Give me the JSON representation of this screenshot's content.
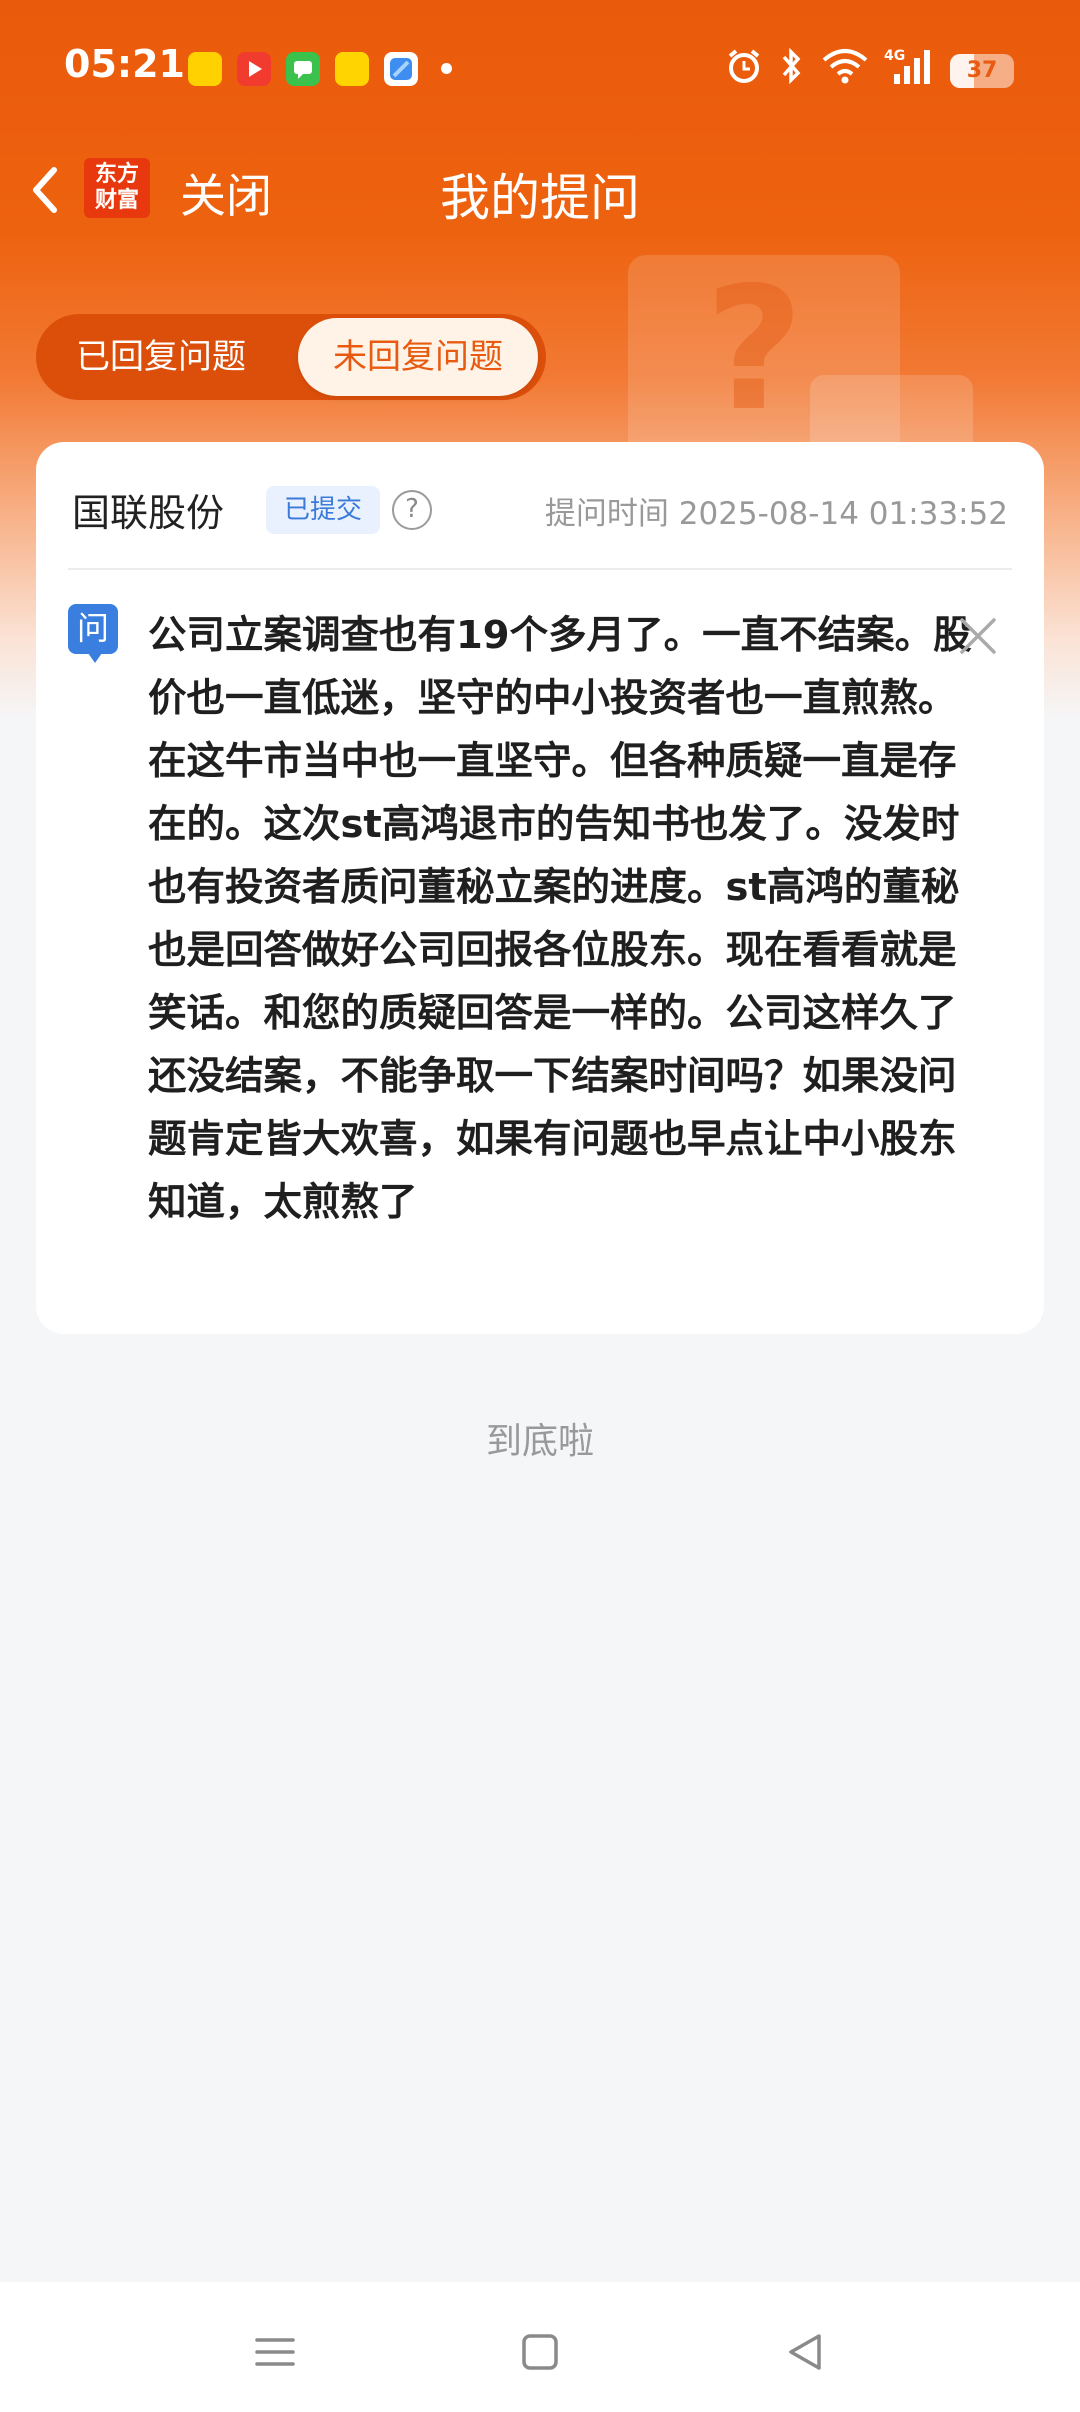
{
  "status_bar": {
    "time": "05:21",
    "network": "4G",
    "battery": "37",
    "battery_level": 0.37,
    "notification_apps": [
      "meituan-app-icon",
      "video-app-icon",
      "messages-app-icon",
      "yellow-app-icon",
      "blue-app-icon"
    ]
  },
  "header": {
    "brand_line1": "东方",
    "brand_line2": "财富",
    "close_label": "关闭",
    "title": "我的提问"
  },
  "tabs": [
    {
      "label": "已回复问题",
      "selected": false
    },
    {
      "label": "未回复问题",
      "selected": true
    }
  ],
  "question_card": {
    "company": "国联股份",
    "status_badge": "已提交",
    "help_glyph": "?",
    "ask_time": "提问时间 2025-08-14 01:33:52",
    "question_tag": "问",
    "question_text": "公司立案调查也有19个多月了。一直不结案。股价也一直低迷，坚守的中小投资者也一直煎熬。在这牛市当中也一直坚守。但各种质疑一直是存在的。这次st高鸿退市的告知书也发了。没发时也有投资者质问董秘立案的进度。st高鸿的董秘也是回答做好公司回报各位股东。现在看看就是笑话。和您的质疑回答是一样的。公司这样久了还没结案，不能争取一下结案时间吗？如果没问题肯定皆大欢喜，如果有问题也早点让中小股东知道，太煎熬了"
  },
  "footer": {
    "end_text": "到底啦"
  },
  "colors": {
    "brand_orange": "#ea5a0c",
    "tab_active_text": "#e85a10",
    "badge_blue": "#3b7ad8",
    "question_icon_blue": "#3a7fe0"
  }
}
